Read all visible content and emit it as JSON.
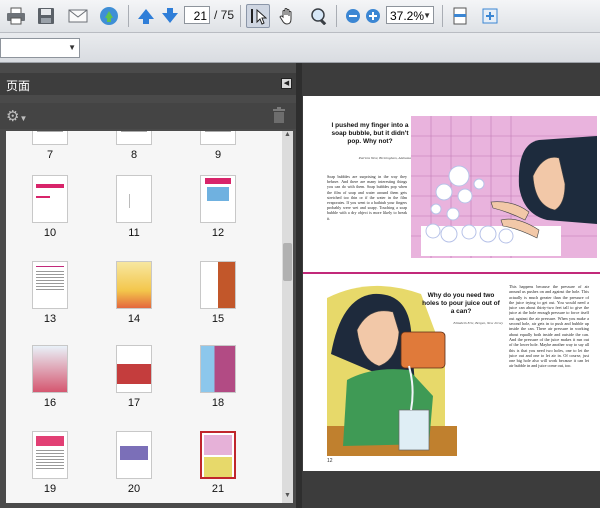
{
  "toolbar": {
    "page_current": "21",
    "page_total": "/ 75",
    "zoom": "37.2%",
    "icons": [
      "print-icon",
      "save-icon",
      "email-icon",
      "upload-icon",
      "prev-page-icon",
      "next-page-icon",
      "select-tool-icon",
      "hand-tool-icon",
      "zoom-tool-icon",
      "zoom-out-icon",
      "zoom-in-icon",
      "fit-page-icon",
      "full-screen-icon"
    ]
  },
  "panel": {
    "title": "页面",
    "thumbnails": [
      {
        "n": "7"
      },
      {
        "n": "8"
      },
      {
        "n": "9"
      },
      {
        "n": "10"
      },
      {
        "n": "11"
      },
      {
        "n": "12"
      },
      {
        "n": "13"
      },
      {
        "n": "14"
      },
      {
        "n": "15"
      },
      {
        "n": "16"
      },
      {
        "n": "17"
      },
      {
        "n": "18"
      },
      {
        "n": "19"
      },
      {
        "n": "20"
      },
      {
        "n": "21",
        "selected": true
      }
    ]
  },
  "document": {
    "heading1": "I pushed my finger into a soap bubble, but it didn't pop. Why not?",
    "byline1": "Patricia West, Birmingham, Alabama",
    "body1": "Soap bubbles are surprising in the way they behave. And there are many interesting things you can do with them. Soap bubbles pop when the film of soap and water around them gets stretched too thin or if the water in the film evaporates. If you went to a bathtub your fingers probably were wet and soapy. Touching a soap bubble with a dry object is more likely to break it.",
    "heading2": "Why do you need two holes to pour juice out of a can?",
    "byline2": "Elizabeth Eric, Bergen, New Jersey",
    "body2": "This happens because the pressure of air around us pushes on and against the hole. This actually is much greater than the pressure of the juice trying to get out. You would need a juice can about thirty-two feet tall to give the juice at the hole enough pressure to force itself out against the air pressure. When you make a second hole, air gets in to push and bubble up inside the can. There air pressure in working about equally both inside and outside the can. And the pressure of the juice makes it run out of the lower hole. Maybe another way to say all this is that you need two holes, one to let the juice out and one to let air in. Of course, just one big hole also will work because it can let air bubble in and juice come out, too.",
    "page_number": "12"
  },
  "colors": {
    "accent": "#c0262c",
    "panel_bg": "#4a4a4a",
    "rule": "#c2297a"
  }
}
